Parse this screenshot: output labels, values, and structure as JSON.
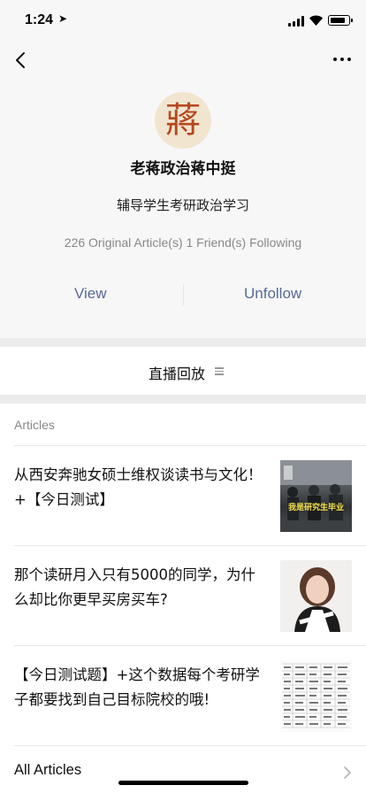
{
  "status": {
    "time": "1:24",
    "location_icon": "location-arrow-icon",
    "battery_level": 0.85
  },
  "nav": {
    "back_icon": "chevron-left-icon",
    "more_icon": "ellipsis-icon"
  },
  "profile": {
    "avatar_char": "蔣",
    "name": "老蒋政治蒋中挺",
    "bio": "辅导学生考研政治学习",
    "stats": "226 Original Article(s)  1 Friend(s) Following",
    "view_label": "View",
    "unfollow_label": "Unfollow"
  },
  "live": {
    "label": "直播回放",
    "icon": "list-icon"
  },
  "articles": {
    "header": "Articles",
    "items": [
      {
        "title": "从西安奔驰女硕士维权谈读书与文化！+【今日测试】",
        "thumb_caption": "我是研究生毕业"
      },
      {
        "title": "那个读研月入只有5000的同学，为什么却比你更早买房买车?",
        "thumb_caption": ""
      },
      {
        "title": "【今日测试题】+这个数据每个考研学子都要找到自己目标院校的哦!",
        "thumb_caption": ""
      }
    ],
    "all_label": "All Articles"
  },
  "colors": {
    "link": "#576b95",
    "muted": "#888888",
    "section_bg": "#f7f7f7",
    "avatar_red": "#b5471f"
  }
}
